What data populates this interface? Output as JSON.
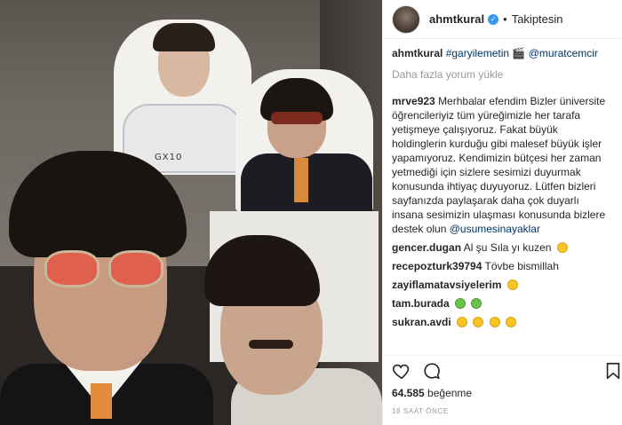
{
  "header": {
    "username": "ahmtkural",
    "separator": "•",
    "follow_status": "Takiptesin"
  },
  "photo": {
    "badge_text": "GX10"
  },
  "caption": {
    "username": "ahmtkural",
    "hashtag": "#garyilemetin",
    "emoji": "🎬",
    "mention": "@muratcemcir"
  },
  "load_more": "Daha fazla yorum yükle",
  "comments": [
    {
      "user": "mrve923",
      "text": "Merhbalar efendim Bizler üniversite öğrencileriyiz tüm yüreğimizle her tarafa yetişmeye çalışıyoruz. Fakat büyük holdinglerin kurduğu gibi malesef büyük işler yapamıyoruz. Kendimizin bütçesi her zaman yetmediği için sizlere sesimizi duyurmak konusunda ihtiyaç duyuyoruz. Lütfen bizleri sayfanızda paylaşarak daha çok duyarlı insana sesimizin ulaşması konusunda bizlere destek olun",
      "mention": "@usumesinayaklar"
    },
    {
      "user": "gencer.dugan",
      "text": "Al şu Sıla yı kuzen"
    },
    {
      "user": "recepozturk39794",
      "text": "Tövbe bismillah"
    },
    {
      "user": "zayiflamatavsiyelerim",
      "text": ""
    },
    {
      "user": "tam.burada",
      "text": ""
    },
    {
      "user": "sukran.avdi",
      "text": ""
    }
  ],
  "likes": {
    "count": "64.585",
    "label": "beğenme"
  },
  "timestamp": "18 SAAT ÖNCE",
  "icons": {
    "like": "heart-icon",
    "comment": "comment-icon",
    "save": "bookmark-icon",
    "verified": "verified-badge-icon"
  },
  "colors": {
    "verified": "#3897f0",
    "link": "#003569",
    "muted": "#999999"
  }
}
